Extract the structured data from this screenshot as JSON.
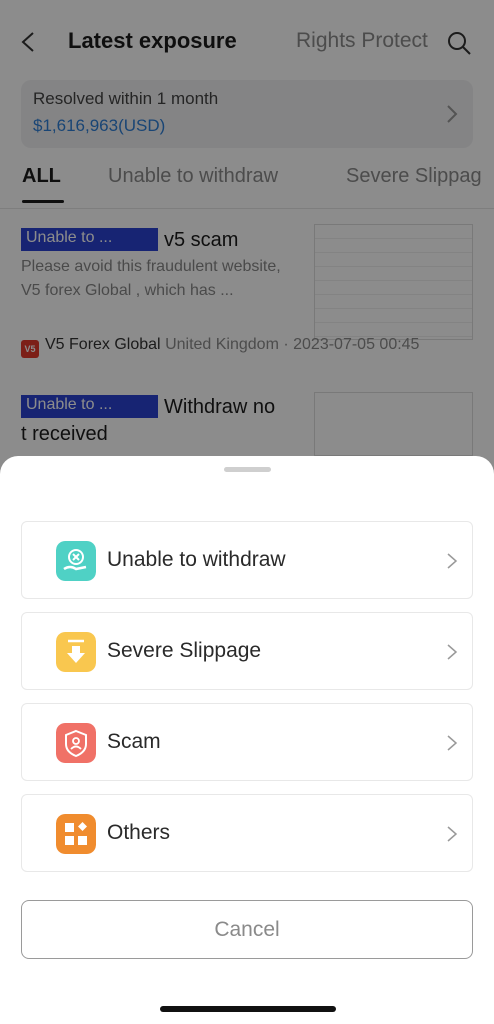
{
  "header": {
    "title": "Latest exposure",
    "rights_tab": "Rights Protect"
  },
  "resolved": {
    "label": "Resolved within 1 month",
    "amount": "$1,616,963(USD)"
  },
  "tabs": [
    {
      "label": "ALL"
    },
    {
      "label": "Unable to withdraw"
    },
    {
      "label": "Severe Slippag"
    }
  ],
  "cards": [
    {
      "badge": "Unable to ...",
      "title": "v5 scam",
      "desc": "Please avoid this fraudulent website, V5 forex Global , which has ...",
      "broker": "V5 Forex Global",
      "broker_logo": "V5",
      "region_date": "United Kingdom · 2023-07-05 00:45"
    },
    {
      "badge": "Unable to ...",
      "title_line1": "Withdraw no",
      "title_line2": "t received"
    }
  ],
  "sheet": {
    "options": [
      {
        "label": "Unable to withdraw",
        "icon": "withdraw-hand-icon",
        "color": "#4fd1c5"
      },
      {
        "label": "Severe Slippage",
        "icon": "download-arrow-icon",
        "color": "#f9c74f"
      },
      {
        "label": "Scam",
        "icon": "shield-icon",
        "color": "#f07167"
      },
      {
        "label": "Others",
        "icon": "grid-icon",
        "color": "#f08c2e"
      }
    ],
    "cancel": "Cancel"
  }
}
